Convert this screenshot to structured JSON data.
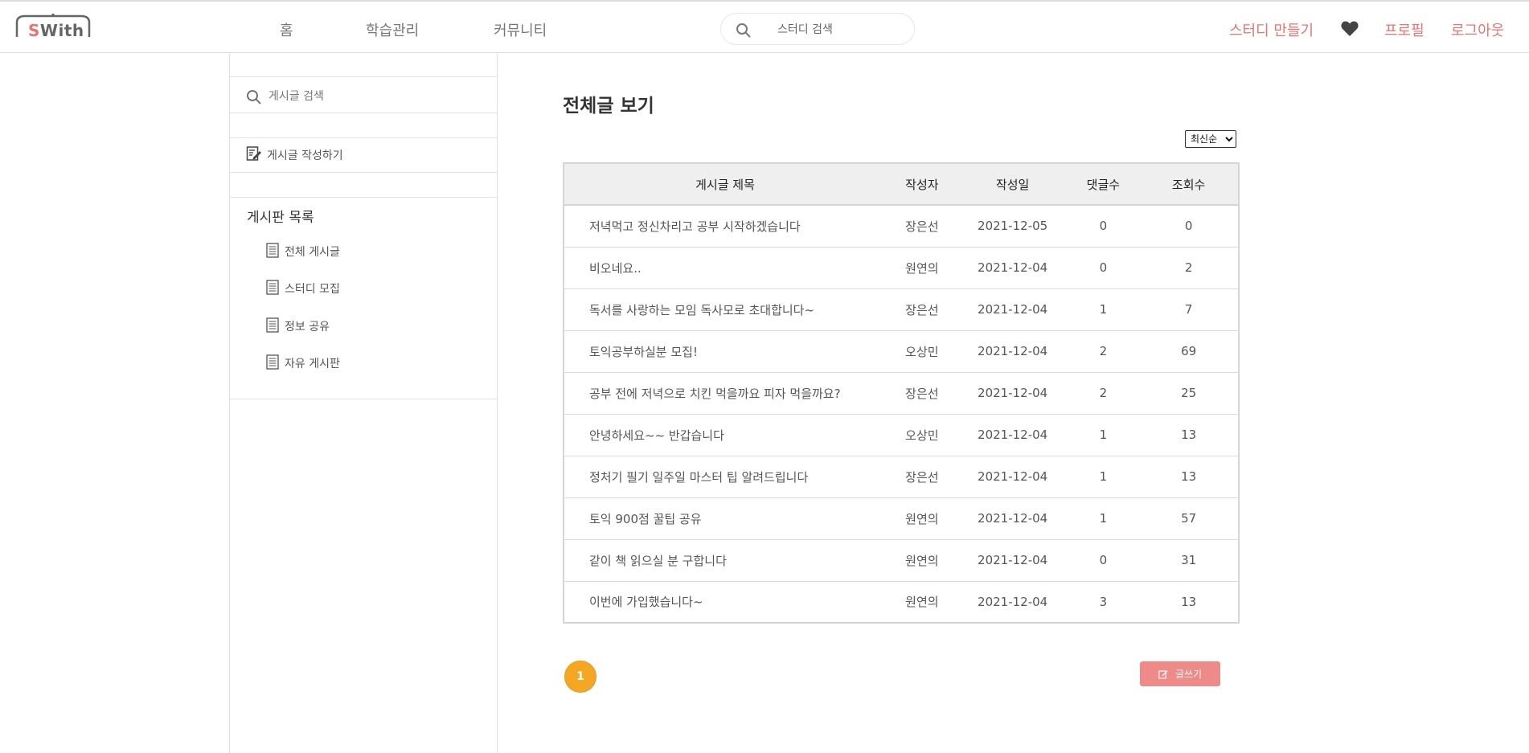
{
  "header": {
    "logo_s": "S",
    "logo_rest": "With",
    "nav": [
      "홈",
      "학습관리",
      "커뮤니티"
    ],
    "search_placeholder": "스터디 검색",
    "create_study": "스터디 만들기",
    "profile": "프로필",
    "logout": "로그아웃"
  },
  "sidebar": {
    "search_placeholder": "게시글 검색",
    "write_label": "게시글 작성하기",
    "board_title": "게시판 목록",
    "boards": [
      "전체 게시글",
      "스터디 모집",
      "정보 공유",
      "자유 게시판"
    ]
  },
  "main": {
    "title": "전체글 보기",
    "sort_options": [
      "최신순"
    ],
    "columns": [
      "게시글 제목",
      "작성자",
      "작성일",
      "댓글수",
      "조회수"
    ],
    "rows": [
      {
        "title": "저녁먹고 정신차리고 공부 시작하겠습니다",
        "author": "장은선",
        "date": "2021-12-05",
        "comments": "0",
        "views": "0"
      },
      {
        "title": "비오네요..",
        "author": "원연의",
        "date": "2021-12-04",
        "comments": "0",
        "views": "2"
      },
      {
        "title": "독서를 사랑하는 모임 독사모로 초대합니다~",
        "author": "장은선",
        "date": "2021-12-04",
        "comments": "1",
        "views": "7"
      },
      {
        "title": "토익공부하실분 모집!",
        "author": "오상민",
        "date": "2021-12-04",
        "comments": "2",
        "views": "69"
      },
      {
        "title": "공부 전에 저녁으로 치킨 먹을까요 피자 먹을까요?",
        "author": "장은선",
        "date": "2021-12-04",
        "comments": "2",
        "views": "25"
      },
      {
        "title": "안녕하세요~~ 반갑습니다",
        "author": "오상민",
        "date": "2021-12-04",
        "comments": "1",
        "views": "13"
      },
      {
        "title": "정처기 필기 일주일 마스터 팁 알려드립니다",
        "author": "장은선",
        "date": "2021-12-04",
        "comments": "1",
        "views": "13"
      },
      {
        "title": "토익 900점 꿀팁 공유",
        "author": "원연의",
        "date": "2021-12-04",
        "comments": "1",
        "views": "57"
      },
      {
        "title": "같이 책 읽으실 분 구합니다",
        "author": "원연의",
        "date": "2021-12-04",
        "comments": "0",
        "views": "31"
      },
      {
        "title": "이번에 가입했습니다~",
        "author": "원연의",
        "date": "2021-12-04",
        "comments": "3",
        "views": "13"
      }
    ],
    "pagination": [
      "1"
    ],
    "write_button": "글쓰기"
  },
  "colors": {
    "accent": "#e8736f",
    "page_active": "#f5a623",
    "write_button": "#ee8b88"
  },
  "icons": [
    "search-icon",
    "heart-icon",
    "write-icon",
    "document-icon",
    "edit-icon"
  ]
}
